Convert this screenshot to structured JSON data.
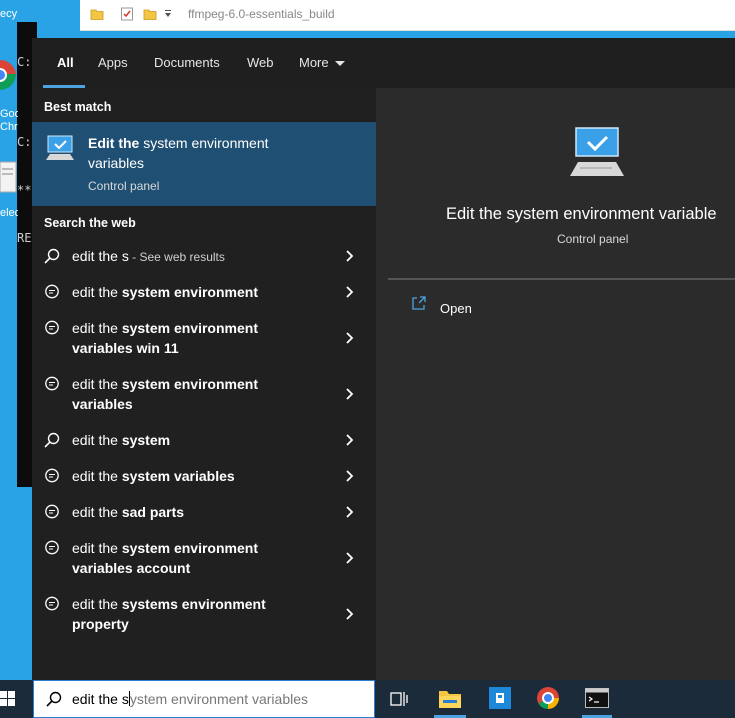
{
  "explorer": {
    "path": "ffmpeg-6.0-essentials_build"
  },
  "cmd": {
    "lines": [
      "C:\\AI\\Fu",
      "",
      "C:",
      "**",
      "RE"
    ]
  },
  "desktop_icons": [
    {
      "label": "ecy"
    },
    {
      "label": "Goo"
    },
    {
      "label": "Chr"
    },
    {
      "label": "elec"
    }
  ],
  "search": {
    "tabs": [
      {
        "label": "All"
      },
      {
        "label": "Apps"
      },
      {
        "label": "Documents"
      },
      {
        "label": "Web"
      },
      {
        "label": "More"
      }
    ],
    "best_match_heading": "Best match",
    "best_match": {
      "title_bold": "Edit the",
      "title_rest": " system environment variables",
      "subtitle": "Control panel"
    },
    "web_heading": "Search the web",
    "results": [
      {
        "icon": "search-icon",
        "plain": "edit the s",
        "bold": "",
        "hint": " - See web results"
      },
      {
        "icon": "chat-icon",
        "plain": "edit the ",
        "bold": "system environment",
        "hint": ""
      },
      {
        "icon": "chat-icon",
        "plain": "edit the ",
        "bold": "system environment variables win 11",
        "hint": ""
      },
      {
        "icon": "chat-icon",
        "plain": "edit the ",
        "bold": "system environment variables",
        "hint": ""
      },
      {
        "icon": "search-icon",
        "plain": "edit the ",
        "bold": "system",
        "hint": ""
      },
      {
        "icon": "chat-icon",
        "plain": "edit the ",
        "bold": "system variables",
        "hint": ""
      },
      {
        "icon": "chat-icon",
        "plain": "edit the ",
        "bold": "sad parts",
        "hint": ""
      },
      {
        "icon": "chat-icon",
        "plain": "edit the ",
        "bold": "system environment variables account",
        "hint": ""
      },
      {
        "icon": "chat-icon",
        "plain": "edit the ",
        "bold": "systems environment property",
        "hint": ""
      }
    ],
    "preview": {
      "title": "Edit the system environment variable",
      "subtitle": "Control panel",
      "open_label": "Open"
    },
    "input": {
      "typed": "edit the s",
      "suggestion": "ystem environment variables"
    }
  },
  "colors": {
    "accent": "#4ca3e0",
    "best_bg": "#1f4f73",
    "pane_bg": "#202020"
  }
}
